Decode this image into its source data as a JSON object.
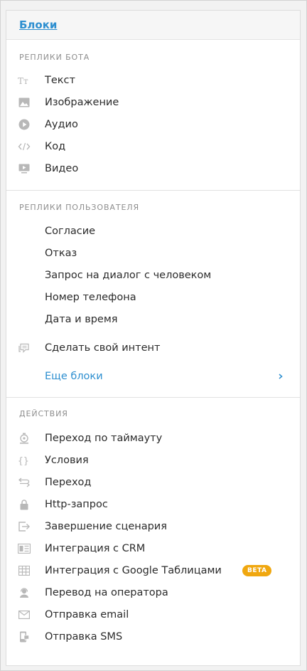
{
  "panel": {
    "title": "Блоки"
  },
  "sections": {
    "bot": {
      "title": "РЕПЛИКИ БОТА",
      "items": [
        {
          "label": "Текст",
          "icon": "text-icon"
        },
        {
          "label": "Изображение",
          "icon": "image-icon"
        },
        {
          "label": "Аудио",
          "icon": "audio-icon"
        },
        {
          "label": "Код",
          "icon": "code-icon"
        },
        {
          "label": "Видео",
          "icon": "video-icon"
        }
      ]
    },
    "user": {
      "title": "РЕПЛИКИ ПОЛЬЗОВАТЕЛЯ",
      "items": [
        {
          "label": "Согласие"
        },
        {
          "label": "Отказ"
        },
        {
          "label": "Запрос на диалог с человеком"
        },
        {
          "label": "Номер телефона"
        },
        {
          "label": "Дата и время"
        }
      ],
      "custom_intent": {
        "label": "Сделать свой интент",
        "icon": "chat-icon"
      },
      "more": {
        "label": "Еще блоки",
        "icon": "chevron-right-icon"
      }
    },
    "actions": {
      "title": "ДЕЙСТВИЯ",
      "items": [
        {
          "label": "Переход по таймауту",
          "icon": "timer-icon"
        },
        {
          "label": "Условия",
          "icon": "braces-icon"
        },
        {
          "label": "Переход",
          "icon": "transition-icon"
        },
        {
          "label": "Http-запрос",
          "icon": "lock-icon"
        },
        {
          "label": "Завершение сценария",
          "icon": "exit-icon"
        },
        {
          "label": "Интеграция с CRM",
          "icon": "crm-icon"
        },
        {
          "label": "Интеграция с Google Таблицами",
          "icon": "table-icon",
          "badge": "BETA"
        },
        {
          "label": "Перевод на оператора",
          "icon": "operator-icon"
        },
        {
          "label": "Отправка email",
          "icon": "email-icon"
        },
        {
          "label": "Отправка SMS",
          "icon": "sms-icon"
        }
      ]
    }
  },
  "colors": {
    "accent": "#2e8fd0",
    "badge": "#f0a70f",
    "icon": "#b8b8b8",
    "text": "#2b2b2b"
  }
}
